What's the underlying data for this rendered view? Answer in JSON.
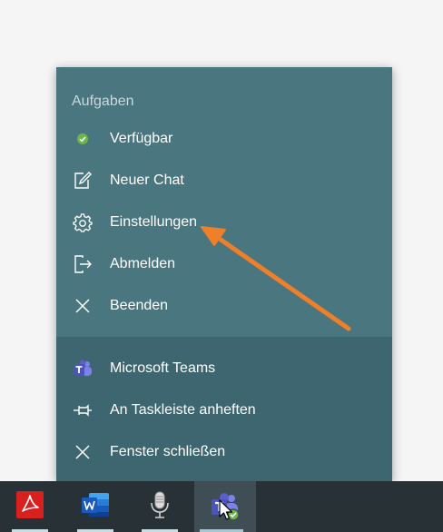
{
  "jumplist": {
    "section_title": "Aufgaben",
    "tasks": [
      {
        "label": "Verfügbar",
        "icon": "status-available-icon"
      },
      {
        "label": "Neuer Chat",
        "icon": "new-chat-icon"
      },
      {
        "label": "Einstellungen",
        "icon": "gear-icon"
      },
      {
        "label": "Abmelden",
        "icon": "sign-out-icon"
      },
      {
        "label": "Beenden",
        "icon": "close-icon"
      }
    ],
    "app_items": [
      {
        "label": "Microsoft Teams",
        "icon": "teams-icon"
      },
      {
        "label": "An Taskleiste anheften",
        "icon": "pin-icon"
      },
      {
        "label": "Fenster schließen",
        "icon": "close-icon"
      }
    ]
  },
  "taskbar": {
    "buttons": [
      {
        "app": "acrobat-reader-icon"
      },
      {
        "app": "word-icon"
      },
      {
        "app": "microphone-icon"
      },
      {
        "app": "teams-icon",
        "active": true
      }
    ]
  },
  "colors": {
    "menu_upper": "#4a7680",
    "menu_lower": "#3e6670",
    "taskbar": "#283236",
    "arrow": "#f07f2a",
    "available": "#6cb64a"
  }
}
